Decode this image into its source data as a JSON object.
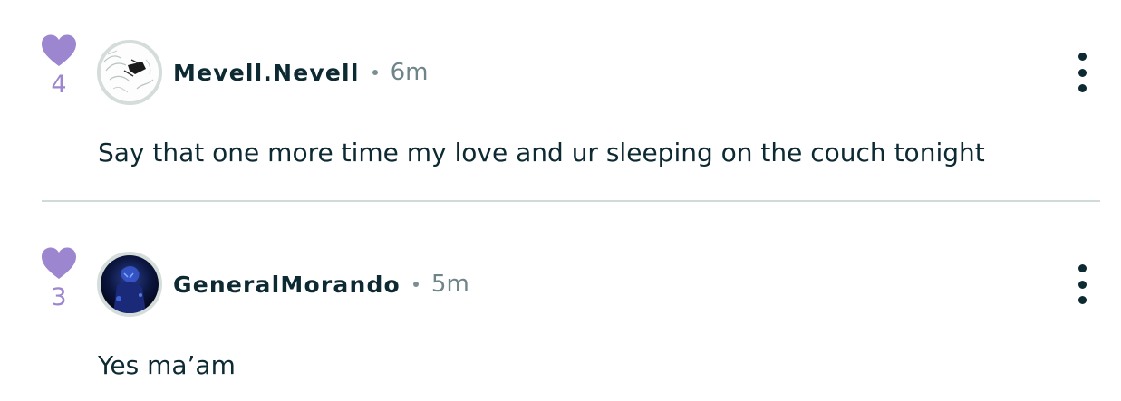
{
  "colors": {
    "accent_heart": "#9b86cf",
    "text_primary": "#0d2a33",
    "text_secondary": "#6f8488",
    "divider": "#cfdbd8"
  },
  "comments": [
    {
      "likes": "4",
      "username": "Mevell.Nevell",
      "time": "6m",
      "text": "Say that one more time my love and ur sleeping on the couch tonight",
      "avatar_icon": "sketch-avatar-icon",
      "menu_icon": "more-vertical-icon"
    },
    {
      "likes": "3",
      "username": "GeneralMorando",
      "time": "5m",
      "text": "Yes ma’am",
      "avatar_icon": "dark-blue-avatar-icon",
      "menu_icon": "more-vertical-icon"
    }
  ]
}
